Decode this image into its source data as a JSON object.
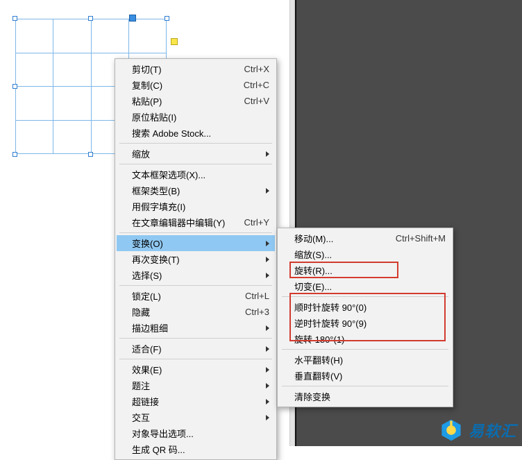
{
  "main_menu": {
    "cut": {
      "label": "剪切(T)",
      "shortcut": "Ctrl+X"
    },
    "copy": {
      "label": "复制(C)",
      "shortcut": "Ctrl+C"
    },
    "paste": {
      "label": "粘贴(P)",
      "shortcut": "Ctrl+V"
    },
    "paste_in_place": {
      "label": "原位粘贴(I)"
    },
    "search_stock": {
      "label": "搜索 Adobe Stock..."
    },
    "zoom": {
      "label": "缩放"
    },
    "text_frame_options": {
      "label": "文本框架选项(X)..."
    },
    "frame_type": {
      "label": "框架类型(B)"
    },
    "fill_placeholder": {
      "label": "用假字填充(I)"
    },
    "edit_in_story": {
      "label": "在文章编辑器中编辑(Y)",
      "shortcut": "Ctrl+Y"
    },
    "transform": {
      "label": "变换(O)"
    },
    "transform_again": {
      "label": "再次变换(T)"
    },
    "select": {
      "label": "选择(S)"
    },
    "lock": {
      "label": "锁定(L)",
      "shortcut": "Ctrl+L"
    },
    "hide": {
      "label": "隐藏",
      "shortcut": "Ctrl+3"
    },
    "stroke_weight": {
      "label": "描边粗细"
    },
    "fit": {
      "label": "适合(F)"
    },
    "effects": {
      "label": "效果(E)"
    },
    "captions": {
      "label": "题注"
    },
    "hyperlinks": {
      "label": "超链接"
    },
    "interactive": {
      "label": "交互"
    },
    "object_export": {
      "label": "对象导出选项..."
    },
    "generate_qr": {
      "label": "生成 QR 码..."
    }
  },
  "sub_menu": {
    "move": {
      "label": "移动(M)...",
      "shortcut": "Ctrl+Shift+M"
    },
    "scale": {
      "label": "缩放(S)..."
    },
    "rotate": {
      "label": "旋转(R)..."
    },
    "shear": {
      "label": "切变(E)..."
    },
    "rotate_cw": {
      "label": "顺时针旋转 90°(0)"
    },
    "rotate_ccw": {
      "label": "逆时针旋转 90°(9)"
    },
    "rotate_180": {
      "label": "旋转 180°(1)"
    },
    "flip_h": {
      "label": "水平翻转(H)"
    },
    "flip_v": {
      "label": "垂直翻转(V)"
    },
    "clear": {
      "label": "清除变换"
    }
  },
  "watermark": {
    "text": "易软汇"
  }
}
